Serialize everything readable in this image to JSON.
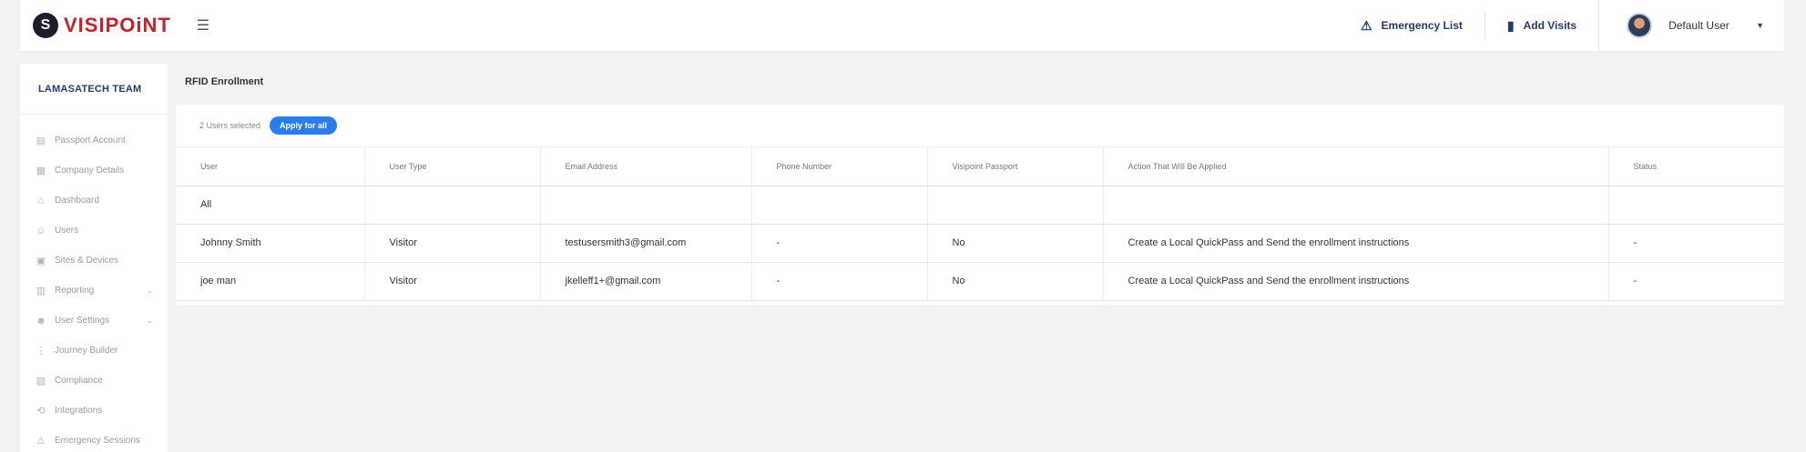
{
  "brand": {
    "name": "VISIPOiNT",
    "mark": "S"
  },
  "header": {
    "emergency_label": "Emergency List",
    "add_visits_label": "Add Visits",
    "user_name": "Default User"
  },
  "sidebar": {
    "team": "LAMASATECH TEAM",
    "items": [
      {
        "label": "Passport Account",
        "icon": "passport-icon"
      },
      {
        "label": "Company Details",
        "icon": "building-icon"
      },
      {
        "label": "Dashboard",
        "icon": "home-icon"
      },
      {
        "label": "Users",
        "icon": "users-icon"
      },
      {
        "label": "Sites & Devices",
        "icon": "devices-icon"
      },
      {
        "label": "Reporting",
        "icon": "report-icon",
        "expandable": true
      },
      {
        "label": "User Settings",
        "icon": "user-settings-icon",
        "expandable": true
      },
      {
        "label": "Journey Builder",
        "icon": "journey-icon"
      },
      {
        "label": "Compliance",
        "icon": "compliance-icon"
      },
      {
        "label": "Integrations",
        "icon": "integrations-icon"
      },
      {
        "label": "Emergency Sessions",
        "icon": "siren-icon"
      }
    ]
  },
  "main": {
    "title": "RFID Enrollment",
    "selected_text": "2 Users selected",
    "apply_all_label": "Apply for all",
    "columns": [
      "User",
      "User Type",
      "Email Address",
      "Phone Number",
      "Visipoint Passport",
      "Action That Will Be Applied",
      "Status"
    ],
    "all_label": "All",
    "rows": [
      {
        "user": "Johnny Smith",
        "type": "Visitor",
        "email": "testusersmith3@gmail.com",
        "phone": "-",
        "passport": "No",
        "action": "Create a Local QuickPass and Send the enrollment instructions",
        "status": "-"
      },
      {
        "user": "joe man",
        "type": "Visitor",
        "email": "jkelleff1+@gmail.com",
        "phone": "-",
        "passport": "No",
        "action": "Create a Local QuickPass and Send the enrollment instructions",
        "status": "-"
      }
    ]
  },
  "colors": {
    "accent": "#2b7de9",
    "brand_red": "#c0232b",
    "navy": "#243b6b"
  }
}
